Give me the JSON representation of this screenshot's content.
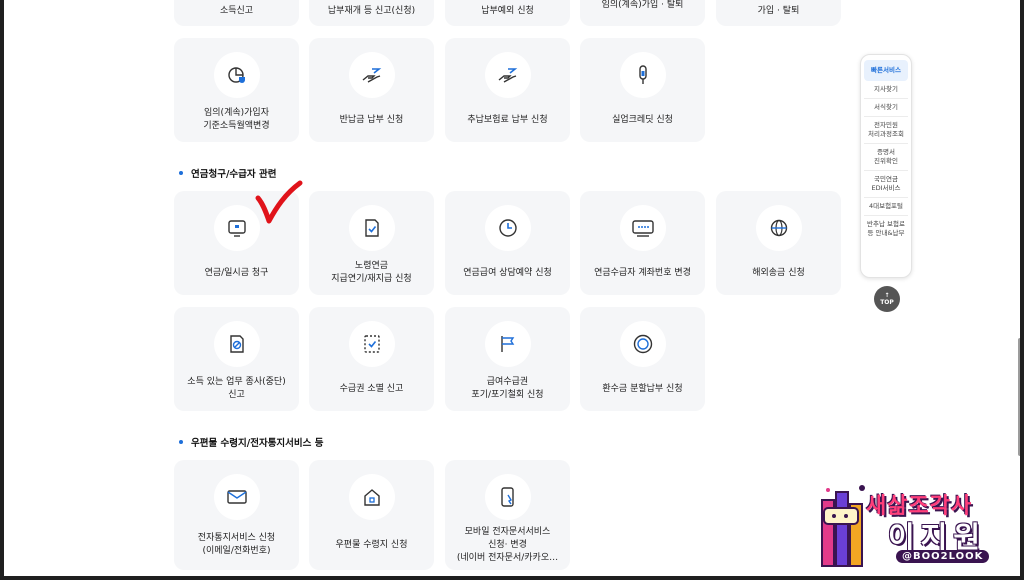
{
  "top_row": [
    "소득신고",
    "납부재개 등 신고(신청)",
    "납부예외 신청",
    "임의(계속)가입 · 탈퇴",
    "가입 · 탈퇴"
  ],
  "row1": [
    {
      "label": "임의(계속)가입자\n기준소득월액변경",
      "icon": "pie-shield-icon"
    },
    {
      "label": "반납금 납부 신청",
      "icon": "hand-coin-icon"
    },
    {
      "label": "추납보험료 납부 신청",
      "icon": "hand-coin-icon"
    },
    {
      "label": "실업크레딧 신청",
      "icon": "pen-icon"
    }
  ],
  "section1": "연금청구/수급자 관련",
  "row2": [
    {
      "label": "연금/일시금 청구",
      "icon": "monitor-icon"
    },
    {
      "label": "노령연금\n지급연기/재지급 신청",
      "icon": "document-check-icon"
    },
    {
      "label": "연금급여 상담예약 신청",
      "icon": "clock-icon"
    },
    {
      "label": "연금수급자 계좌번호 변경",
      "icon": "card-icon"
    },
    {
      "label": "해외송금 신청",
      "icon": "globe-icon"
    }
  ],
  "row3": [
    {
      "label": "소득 있는 업무 종사(중단)\n신고",
      "icon": "document-slash-icon"
    },
    {
      "label": "수급권 소멸 신고",
      "icon": "dashed-document-icon"
    },
    {
      "label": "급여수급권\n포기/포기철회 신청",
      "icon": "flag-icon"
    },
    {
      "label": "환수금 분할납부 신청",
      "icon": "coin-icon"
    }
  ],
  "section2": "우편물 수령지/전자통지서비스 등",
  "row4": [
    {
      "label": "전자통지서비스 신청\n(이메일/전화번호)",
      "icon": "mail-icon"
    },
    {
      "label": "우편물 수령지 신청",
      "icon": "house-icon"
    },
    {
      "label": "모바일 전자문서서비스\n신청· 변경\n(네이버 전자문서/카카오…",
      "icon": "mobile-icon"
    }
  ],
  "quick_panel": [
    "빠른서비스",
    "지사찾기",
    "서식찾기",
    "전자민원\n처리과정조회",
    "증명서\n진위확인",
    "국민연금\nEDI서비스",
    "4대보험포털",
    "반추납 보험료\n등 안내&납부"
  ],
  "top_button": {
    "arrow": "↑",
    "label": "TOP"
  },
  "logo": {
    "line1": "새삶조각사",
    "line2": "이지원",
    "line3": "@BOO2LOOK"
  },
  "colors": {
    "accent": "#1e6fd9",
    "check": "#e0131a",
    "card_bg": "#f5f6f8"
  }
}
